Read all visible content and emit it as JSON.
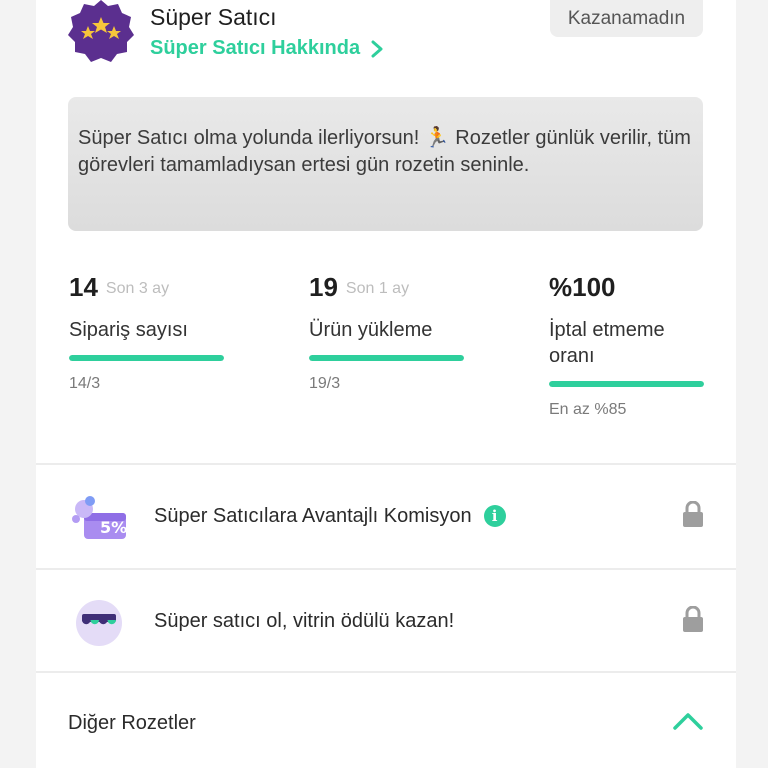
{
  "header": {
    "title": "Süper Satıcı",
    "about_link": "Süper Satıcı Hakkında",
    "status": "Kazanamadın",
    "badge_icon": "stars-badge-icon"
  },
  "info": {
    "message": "Süper Satıcı olma yolunda ilerliyorsun! 🏃 Rozetler günlük verilir, tüm görevleri tamamladıysan ertesi gün rozetin seninle."
  },
  "stats": [
    {
      "value": "14",
      "period": "Son 3 ay",
      "label": "Sipariş sayısı",
      "progress": 1.0,
      "sub": "14/3"
    },
    {
      "value": "19",
      "period": "Son 1 ay",
      "label": "Ürün yükleme",
      "progress": 1.0,
      "sub": "19/3"
    },
    {
      "value": "%100",
      "period": "",
      "label": "İptal etmeme oranı",
      "progress": 1.0,
      "sub": "En az %85"
    }
  ],
  "rewards": [
    {
      "text": "Süper Satıcılara Avantajlı Komisyon",
      "icon": "commission-discount-icon",
      "info_icon": "info-icon",
      "info_glyph": "i",
      "locked": true
    },
    {
      "text": "Süper satıcı ol, vitrin ödülü kazan!",
      "icon": "storefront-icon",
      "locked": true
    }
  ],
  "other": {
    "title": "Diğer Rozetler",
    "icon": "chevron-up-icon"
  },
  "colors": {
    "accent": "#2ecf9c",
    "badge_purple": "#5b2f8f",
    "badge_star": "#f6c53b",
    "lock": "#9e9e9e"
  }
}
